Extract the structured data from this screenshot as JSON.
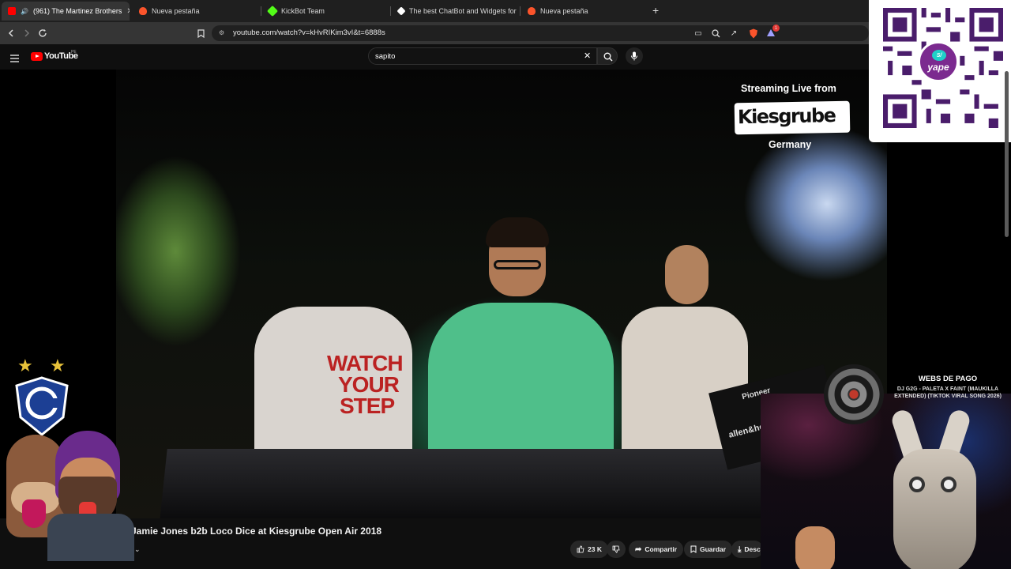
{
  "browser": {
    "tabs": [
      {
        "title": "(961) The Martinez Brothers",
        "favicon_color": "#ff0000",
        "active": true
      },
      {
        "title": "Nueva pestaña",
        "favicon_color": "#fb542b",
        "active": false
      },
      {
        "title": "KickBot Team",
        "favicon_color": "#53fc18",
        "active": false
      },
      {
        "title": "The best ChatBot and Widgets for Ki",
        "favicon_color": "#ffffff",
        "active": false
      },
      {
        "title": "Nueva pestaña",
        "favicon_color": "#fb542b",
        "active": false
      }
    ],
    "new_tab_symbol": "+",
    "url": "youtube.com/watch?v=kHvRIKim3vI&t=6888s",
    "shields_badge": "1"
  },
  "youtube": {
    "logo_text": "YouTube",
    "logo_region": "PE",
    "search_value": "sapito",
    "video_title": "Jamie Jones b2b Loco Dice at Kiesgrube Open Air 2018",
    "actions": {
      "like_count": "23 K",
      "share": "Compartir",
      "save": "Guardar",
      "download": "Desc"
    }
  },
  "video_overlay": {
    "streaming_text": "Streaming Live from",
    "venue": "Kiesgrube",
    "country": "Germany",
    "shirt_text": [
      "WATCH",
      "YOUR",
      "STEP"
    ],
    "mixer_brand": "Pioneer",
    "mixer_model": "allen&heath"
  },
  "stream_overlay": {
    "qr_brand": "yape",
    "now_playing_title": "WEBS DE PAGO",
    "now_playing_song": "DJ G2G - PALETA X FAINT (MAUKILLA EXTENDED) (TIKTOK VIRAL SONG 2026)"
  },
  "colors": {
    "accent_red": "#ff0000",
    "yape_purple": "#7b2a8f",
    "chrome_bg": "#1f1f1f"
  }
}
